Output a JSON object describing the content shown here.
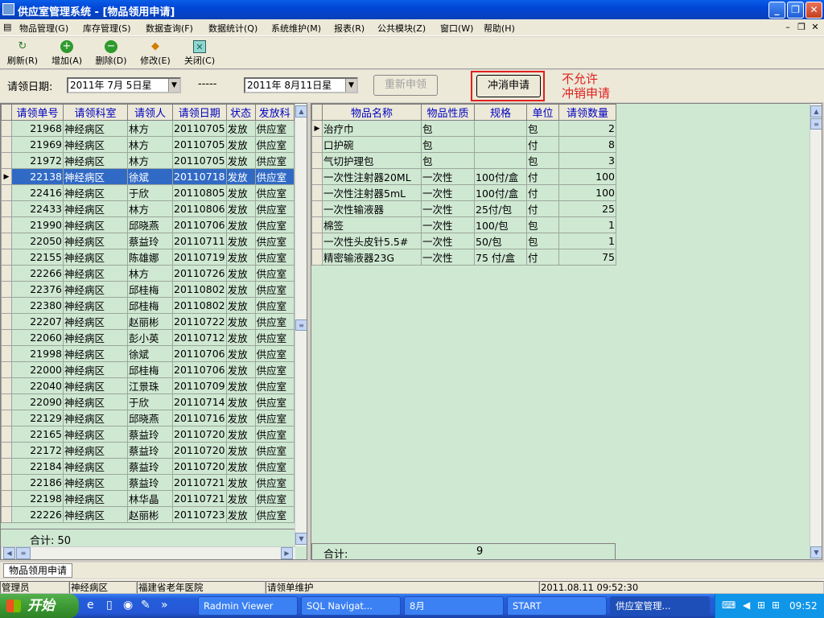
{
  "window": {
    "title": "供应室管理系统 - [物品领用申请]",
    "min": "_",
    "max": "❐",
    "close": "✕"
  },
  "menu": {
    "items": [
      "物品管理(G)",
      "库存管理(S)",
      "数据查询(F)",
      "数据统计(Q)",
      "系统维护(M)",
      "报表(R)",
      "公共模块(Z)",
      "窗口(W)",
      "帮助(H)"
    ],
    "mdi_min": "–",
    "mdi_restore": "❐",
    "mdi_close": "✕"
  },
  "toolbar": {
    "refresh": "刷新(R)",
    "add": "增加(A)",
    "delete": "删除(D)",
    "edit": "修改(E)",
    "close": "关闭(C)"
  },
  "filter": {
    "label": "请领日期:",
    "date_from": "2011年 7月 5日星",
    "separator": "-----",
    "date_to": "2011年 8月11日星",
    "reapply": "重新申领",
    "cancel": "冲消申请",
    "note_line1": "不允许",
    "note_line2": "冲销申请"
  },
  "left_grid": {
    "columns": [
      "请领单号",
      "请领科室",
      "请领人",
      "请领日期",
      "状态",
      "发放科"
    ],
    "rows": [
      [
        "21968",
        "神经病区",
        "林方",
        "20110705",
        "发放",
        "供应室"
      ],
      [
        "21969",
        "神经病区",
        "林方",
        "20110705",
        "发放",
        "供应室"
      ],
      [
        "21972",
        "神经病区",
        "林方",
        "20110705",
        "发放",
        "供应室"
      ],
      [
        "22138",
        "神经病区",
        "徐斌",
        "20110718",
        "发放",
        "供应室"
      ],
      [
        "22416",
        "神经病区",
        "于欣",
        "20110805",
        "发放",
        "供应室"
      ],
      [
        "22433",
        "神经病区",
        "林方",
        "20110806",
        "发放",
        "供应室"
      ],
      [
        "21990",
        "神经病区",
        "邱晓燕",
        "20110706",
        "发放",
        "供应室"
      ],
      [
        "22050",
        "神经病区",
        "蔡益玲",
        "20110711",
        "发放",
        "供应室"
      ],
      [
        "22155",
        "神经病区",
        "陈雄娜",
        "20110719",
        "发放",
        "供应室"
      ],
      [
        "22266",
        "神经病区",
        "林方",
        "20110726",
        "发放",
        "供应室"
      ],
      [
        "22376",
        "神经病区",
        "邱桂梅",
        "20110802",
        "发放",
        "供应室"
      ],
      [
        "22380",
        "神经病区",
        "邱桂梅",
        "20110802",
        "发放",
        "供应室"
      ],
      [
        "22207",
        "神经病区",
        "赵丽彬",
        "20110722",
        "发放",
        "供应室"
      ],
      [
        "22060",
        "神经病区",
        "彭小英",
        "20110712",
        "发放",
        "供应室"
      ],
      [
        "21998",
        "神经病区",
        "徐斌",
        "20110706",
        "发放",
        "供应室"
      ],
      [
        "22000",
        "神经病区",
        "邱桂梅",
        "20110706",
        "发放",
        "供应室"
      ],
      [
        "22040",
        "神经病区",
        "江景珠",
        "20110709",
        "发放",
        "供应室"
      ],
      [
        "22090",
        "神经病区",
        "于欣",
        "20110714",
        "发放",
        "供应室"
      ],
      [
        "22129",
        "神经病区",
        "邱晓燕",
        "20110716",
        "发放",
        "供应室"
      ],
      [
        "22165",
        "神经病区",
        "蔡益玲",
        "20110720",
        "发放",
        "供应室"
      ],
      [
        "22172",
        "神经病区",
        "蔡益玲",
        "20110720",
        "发放",
        "供应室"
      ],
      [
        "22184",
        "神经病区",
        "蔡益玲",
        "20110720",
        "发放",
        "供应室"
      ],
      [
        "22186",
        "神经病区",
        "蔡益玲",
        "20110721",
        "发放",
        "供应室"
      ],
      [
        "22198",
        "神经病区",
        "林华晶",
        "20110721",
        "发放",
        "供应室"
      ],
      [
        "22226",
        "神经病区",
        "赵丽彬",
        "20110723",
        "发放",
        "供应室"
      ]
    ],
    "selected_index": 3,
    "total_label": "合计: 50"
  },
  "right_grid": {
    "columns": [
      "物品名称",
      "物品性质",
      "规格",
      "单位",
      "请领数量"
    ],
    "rows": [
      [
        "治疗巾",
        "包",
        "",
        "包",
        "2"
      ],
      [
        "口护碗",
        "包",
        "",
        "付",
        "8"
      ],
      [
        "气切护理包",
        "包",
        "",
        "包",
        "3"
      ],
      [
        "一次性注射器20ML",
        "一次性",
        "100付/盒",
        "付",
        "100"
      ],
      [
        "一次性注射器5mL",
        "一次性",
        "100付/盒",
        "付",
        "100"
      ],
      [
        "一次性输液器",
        "一次性",
        "25付/包",
        "付",
        "25"
      ],
      [
        "棉签",
        "一次性",
        "100/包",
        "包",
        "1"
      ],
      [
        "一次性头皮针5.5#",
        "一次性",
        "50/包",
        "包",
        "1"
      ],
      [
        "精密输液器23G",
        "一次性",
        "75 付/盒",
        "付",
        "75"
      ]
    ],
    "total_label": "合计:",
    "total_value": "9"
  },
  "tabs": {
    "active": "物品领用申请"
  },
  "status": {
    "user": "管理员",
    "dept": "神经病区",
    "hospital": "福建省老年医院",
    "module": "请领单维护",
    "datetime": "2011.08.11 09:52:30"
  },
  "taskbar": {
    "start": "开始",
    "tasks": [
      "Radmin Viewer",
      "SQL Navigat...",
      "8月",
      "START",
      "供应室管理..."
    ],
    "time": "09:52"
  }
}
